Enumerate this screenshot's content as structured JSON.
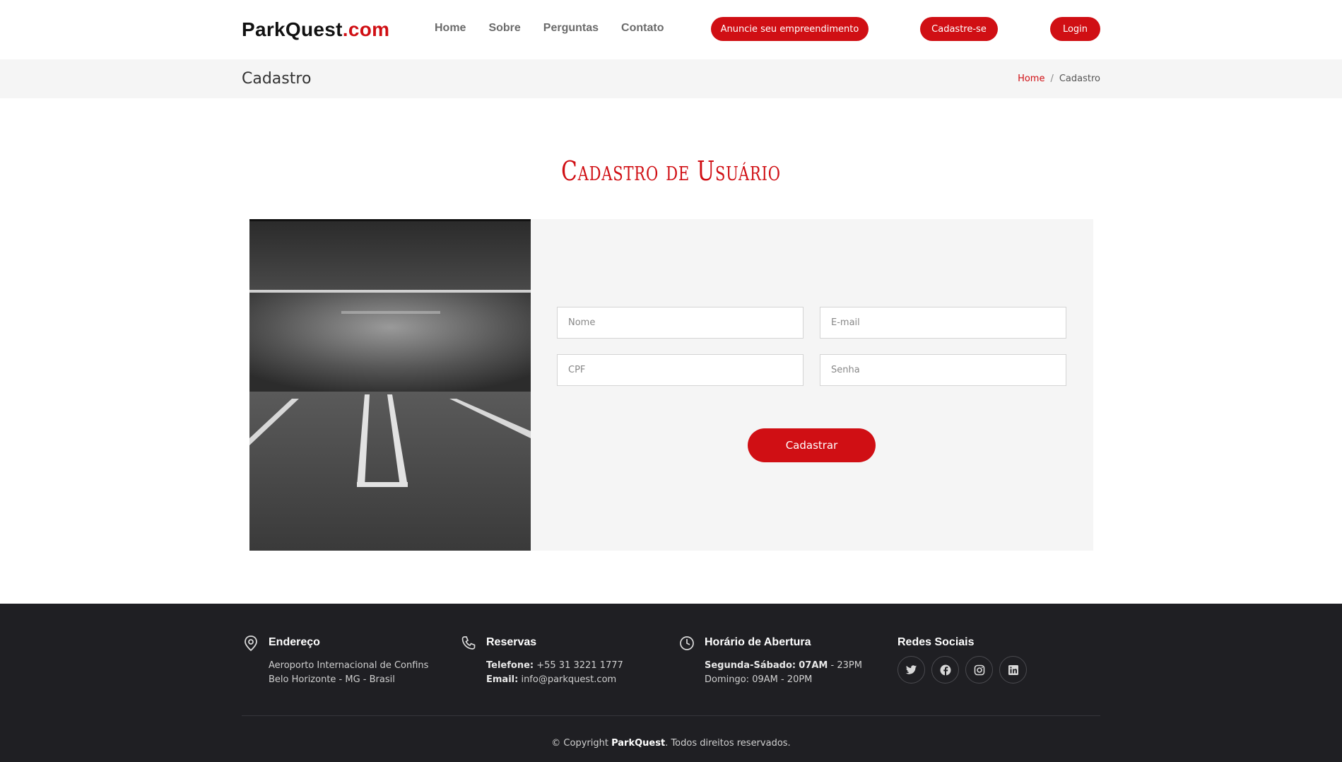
{
  "brand": {
    "name": "ParkQuest",
    "suffix": ".com"
  },
  "nav": {
    "home": "Home",
    "sobre": "Sobre",
    "perguntas": "Perguntas",
    "contato": "Contato"
  },
  "header_buttons": {
    "anuncie": "Anuncie seu empreendimento",
    "cadastre": "Cadastre-se",
    "login": "Login"
  },
  "page": {
    "title": "Cadastro",
    "breadcrumb_home": "Home",
    "breadcrumb_sep": "/",
    "breadcrumb_current": "Cadastro"
  },
  "section": {
    "title": "Cadastro de Usuário"
  },
  "form": {
    "nome_placeholder": "Nome",
    "email_placeholder": "E-mail",
    "cpf_placeholder": "CPF",
    "senha_placeholder": "Senha",
    "submit": "Cadastrar"
  },
  "footer": {
    "address": {
      "title": "Endereço",
      "line1": "Aeroporto Internacional de Confins",
      "line2": "Belo Horizonte - MG - Brasil"
    },
    "reservas": {
      "title": "Reservas",
      "phone_label": "Telefone:",
      "phone": "+55 31 3221 1777",
      "email_label": "Email:",
      "email": "info@parkquest.com"
    },
    "hours": {
      "title": "Horário de Abertura",
      "weekdays_label": "Segunda-Sábado:",
      "weekdays_open": "07AM",
      "weekdays_close": "- 23PM",
      "sunday": "Domingo: 09AM - 20PM"
    },
    "social": {
      "title": "Redes Sociais",
      "icons": [
        "twitter-icon",
        "facebook-icon",
        "instagram-icon",
        "linkedin-icon"
      ]
    },
    "copyright_prefix": "© Copyright",
    "copyright_brand": "ParkQuest",
    "copyright_suffix": ". Todos direitos reservados."
  },
  "colors": {
    "accent": "#d00f14",
    "footer_bg": "#1f1f23",
    "panel_bg": "#f5f5f5"
  }
}
